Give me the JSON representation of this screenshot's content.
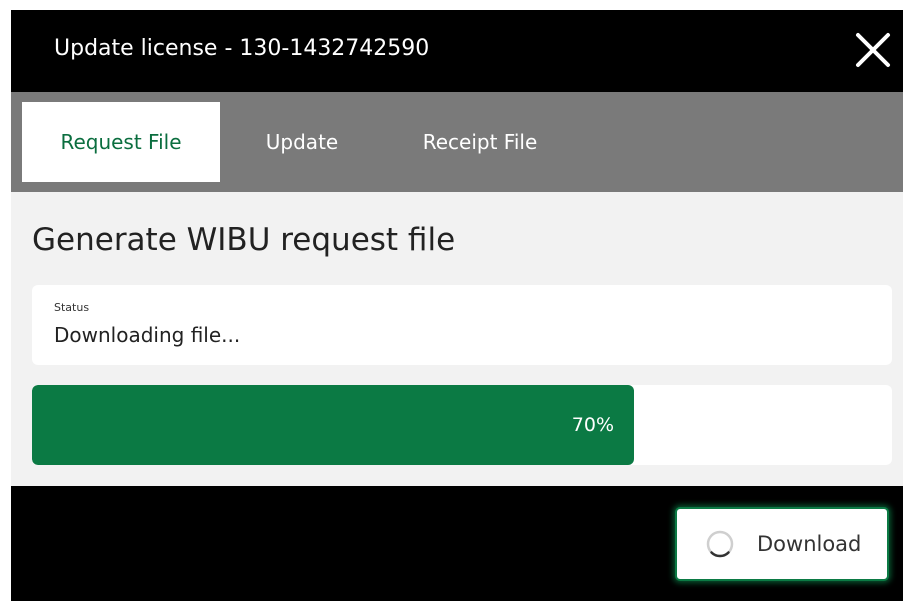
{
  "dialog": {
    "title": "Update license - 130-1432742590"
  },
  "tabs": [
    {
      "label": "Request File",
      "active": true
    },
    {
      "label": "Update",
      "active": false
    },
    {
      "label": "Receipt File",
      "active": false
    }
  ],
  "content": {
    "heading": "Generate WIBU request file",
    "status": {
      "label": "Status",
      "value": "Downloading file..."
    },
    "progress": {
      "percent": 70,
      "label": "70%"
    }
  },
  "footer": {
    "download_label": "Download"
  },
  "icons": {
    "close": "close-icon",
    "spinner": "loading-spinner-icon"
  },
  "colors": {
    "accent": "#0b7a44",
    "active_tab_text": "#0b6e3f",
    "tabbar": "#7a7a7a"
  }
}
